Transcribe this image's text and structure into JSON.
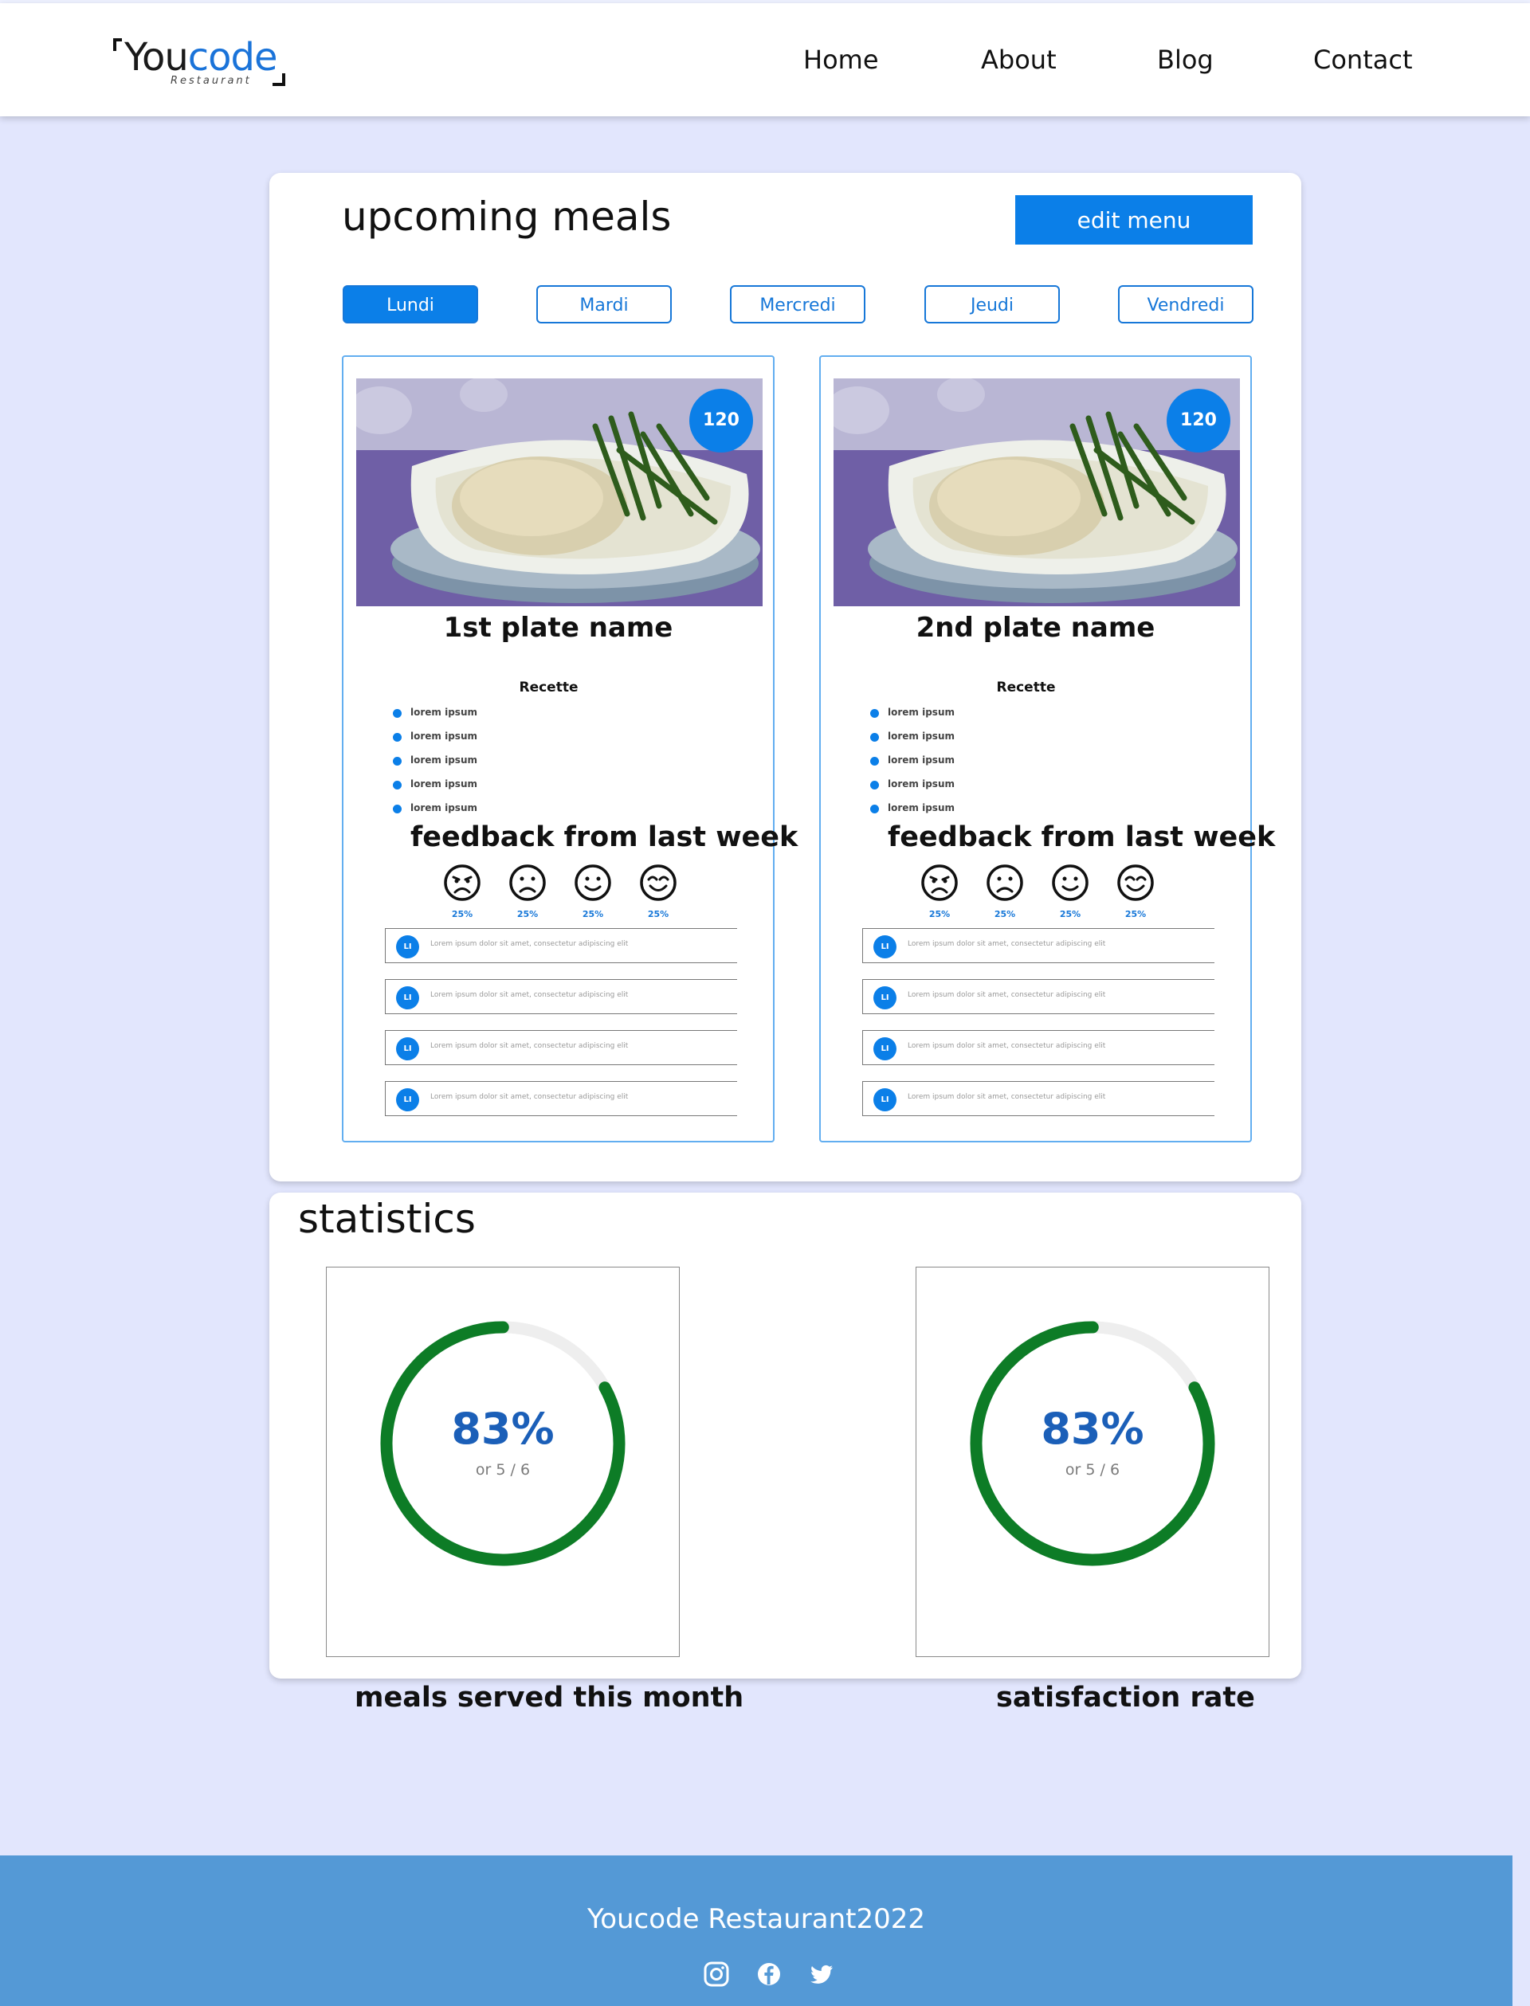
{
  "brand": {
    "name_part1": "You",
    "name_part2": "code",
    "subtitle": "Restaurant"
  },
  "nav": {
    "home": "Home",
    "about": "About",
    "blog": "Blog",
    "contact": "Contact"
  },
  "meals_section": {
    "title": "upcoming meals",
    "edit_button": "edit menu",
    "days": [
      "Lundi",
      "Mardi",
      "Mercredi",
      "Jeudi",
      "Vendredi"
    ],
    "active_day": "Lundi",
    "plates": [
      {
        "badge": "120",
        "name": "1st plate name",
        "recipe_title": "Recette",
        "ingredients": [
          "lorem ipsum",
          "lorem ipsum",
          "lorem ipsum",
          "lorem ipsum",
          "lorem ipsum"
        ],
        "feedback_title": "feedback from last week",
        "feedback": [
          {
            "icon": "very-sad-face-icon",
            "pct": "25%"
          },
          {
            "icon": "sad-face-icon",
            "pct": "25%"
          },
          {
            "icon": "smile-face-icon",
            "pct": "25%"
          },
          {
            "icon": "happy-face-icon",
            "pct": "25%"
          }
        ],
        "comments": [
          {
            "avatar": "LI",
            "text": "Lorem ipsum dolor sit amet, consectetur adipiscing elit"
          },
          {
            "avatar": "LI",
            "text": "Lorem ipsum dolor sit amet, consectetur adipiscing elit"
          },
          {
            "avatar": "LI",
            "text": "Lorem ipsum dolor sit amet, consectetur adipiscing elit"
          },
          {
            "avatar": "LI",
            "text": "Lorem ipsum dolor sit amet, consectetur adipiscing elit"
          }
        ]
      },
      {
        "badge": "120",
        "name": "2nd plate name",
        "recipe_title": "Recette",
        "ingredients": [
          "lorem ipsum",
          "lorem ipsum",
          "lorem ipsum",
          "lorem ipsum",
          "lorem ipsum"
        ],
        "feedback_title": "feedback from last week",
        "feedback": [
          {
            "icon": "very-sad-face-icon",
            "pct": "25%"
          },
          {
            "icon": "sad-face-icon",
            "pct": "25%"
          },
          {
            "icon": "smile-face-icon",
            "pct": "25%"
          },
          {
            "icon": "happy-face-icon",
            "pct": "25%"
          }
        ],
        "comments": [
          {
            "avatar": "LI",
            "text": "Lorem ipsum dolor sit amet, consectetur adipiscing elit"
          },
          {
            "avatar": "LI",
            "text": "Lorem ipsum dolor sit amet, consectetur adipiscing elit"
          },
          {
            "avatar": "LI",
            "text": "Lorem ipsum dolor sit amet, consectetur adipiscing elit"
          },
          {
            "avatar": "LI",
            "text": "Lorem ipsum dolor sit amet, consectetur adipiscing elit"
          }
        ]
      }
    ]
  },
  "stats_section": {
    "title": "statistics",
    "cards": [
      {
        "value": "83%",
        "sub": "or 5 / 6",
        "fraction": 0.83,
        "label": "meals served this month"
      },
      {
        "value": "83%",
        "sub": "or 5 / 6",
        "fraction": 0.83,
        "label": "satisfaction rate"
      }
    ]
  },
  "footer": {
    "text": "Youcode Restaurant2022",
    "social": [
      "instagram-icon",
      "facebook-icon",
      "twitter-icon"
    ]
  },
  "colors": {
    "accent": "#0b7fe8",
    "page_bg": "#e2e6fd",
    "footer_bg": "#5499d6",
    "ring": "#0d7c26",
    "ring_track": "#eeeeee"
  }
}
